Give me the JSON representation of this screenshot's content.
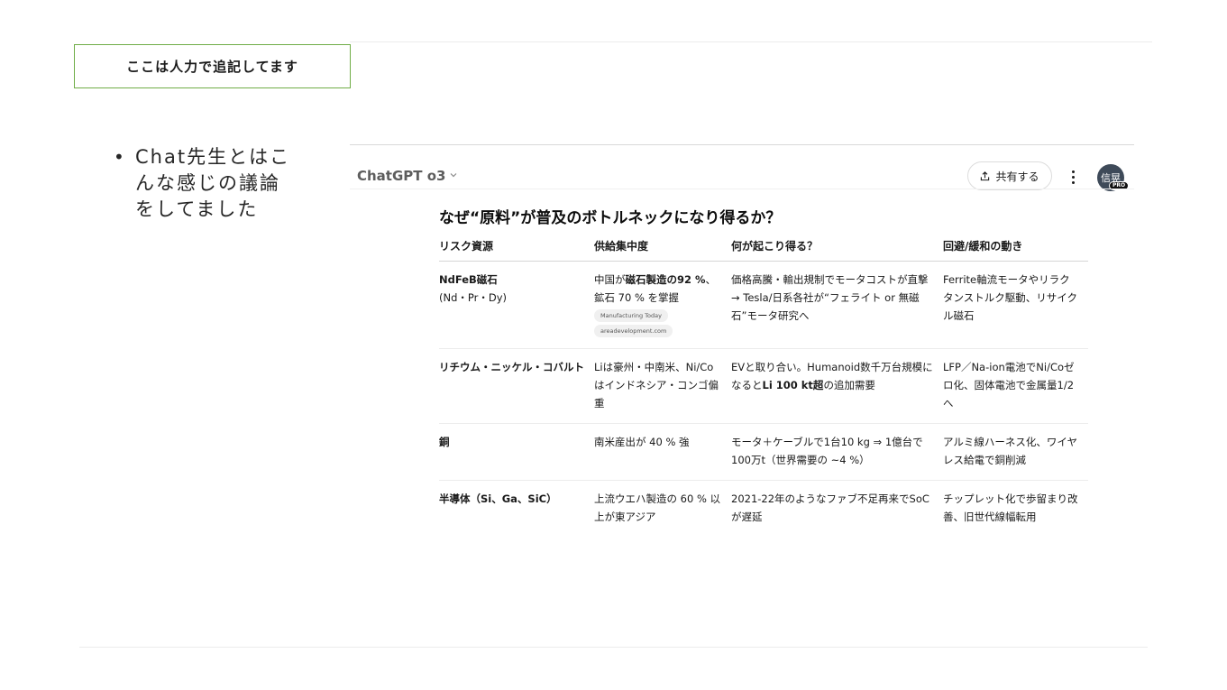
{
  "slide": {
    "note_box": "ここは人力で追記してます",
    "bullet": "Chat先生とはこんな感じの議論をしてました"
  },
  "chat": {
    "app_title": "ChatGPT o3",
    "share_label": "共有する",
    "avatar_text": "信晃",
    "avatar_badge": "PRO",
    "heading": "なぜ“原料”が普及のボトルネックになり得るか？",
    "table": {
      "headers": [
        "リスク資源",
        "供給集中度",
        "何が起こり得る？",
        "回避/緩和の動き"
      ],
      "rows": [
        {
          "resource_bold": "NdFeB磁石",
          "resource_sub": "(Nd・Pr・Dy)",
          "supply_pre": "中国が",
          "supply_bold": "磁石製造の92 %",
          "supply_post": "、鉱石 70 % を掌握",
          "sources": [
            "Manufacturing Today",
            "areadevelopment.com"
          ],
          "impact_line1": "価格高騰・輸出規制でモータコストが直撃",
          "impact_line2": "→ Tesla/日系各社が“フェライト or 無磁石”モータ研究へ",
          "mitigation": "Ferrite軸流モータやリラクタンストルク駆動、リサイクル磁石"
        },
        {
          "resource_bold": "リチウム・ニッケル・コバルト",
          "supply": "Liは豪州・中南米、Ni/Coはインドネシア・コンゴ偏重",
          "impact_pre": "EVと取り合い。Humanoid数千万台規模になると",
          "impact_bold": "Li 100 kt超",
          "impact_post": "の追加需要",
          "mitigation": "LFP／Na-ion電池でNi/Coゼロ化、固体電池で金属量1/2へ"
        },
        {
          "resource_bold": "銅",
          "supply": "南米産出が 40 % 強",
          "impact": "モータ＋ケーブルで1台10 kg ⇒ 1億台で100万t（世界需要の ~4 %）",
          "mitigation": "アルミ線ハーネス化、ワイヤレス給電で銅削減"
        },
        {
          "resource_bold": "半導体（Si、Ga、SiC）",
          "supply": "上流ウエハ製造の 60 % 以上が東アジア",
          "impact": "2021-22年のようなファブ不足再来でSoCが遅延",
          "mitigation": "チップレット化で歩留まり改善、旧世代線幅転用"
        }
      ]
    }
  }
}
